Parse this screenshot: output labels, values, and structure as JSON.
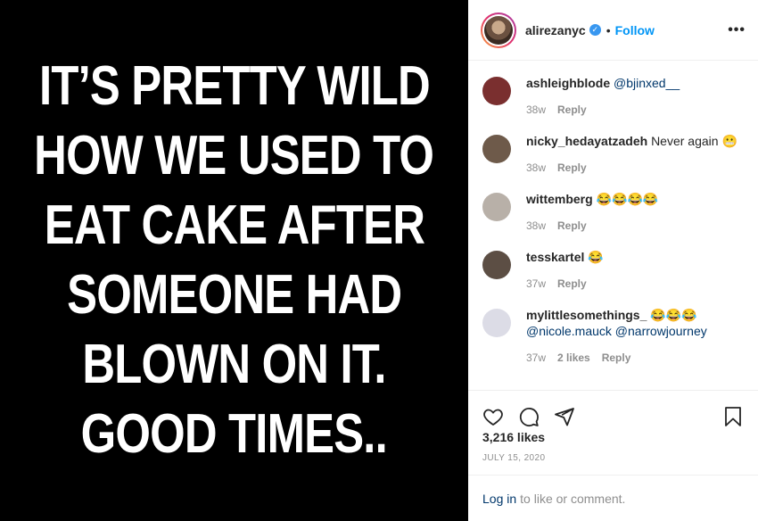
{
  "meme": {
    "lines": [
      "IT’S PRETTY WILD",
      "HOW WE USED TO",
      "EAT CAKE AFTER",
      "SOMEONE HAD",
      "BLOWN ON IT.",
      "GOOD TIMES.."
    ]
  },
  "header": {
    "username": "alirezanyc",
    "verified_mark": "✓",
    "separator": "•",
    "follow_label": "Follow",
    "more_label": "•••"
  },
  "comments": [
    {
      "user": "ashleighblode",
      "text": "",
      "mention": "@bjinxed__",
      "time": "38w",
      "likes": "",
      "reply": "Reply",
      "avatar_color": "#7a2f2f"
    },
    {
      "user": "nicky_hedayatzadeh",
      "text": "Never again 😬",
      "mention": "",
      "time": "38w",
      "likes": "",
      "reply": "Reply",
      "avatar_color": "#6e5a4a"
    },
    {
      "user": "wittemberg",
      "text": "😂😂😂😂",
      "mention": "",
      "time": "38w",
      "likes": "",
      "reply": "Reply",
      "avatar_color": "#b8b0a8"
    },
    {
      "user": "tesskartel",
      "text": "😂",
      "mention": "",
      "time": "37w",
      "likes": "",
      "reply": "Reply",
      "avatar_color": "#5c4e44"
    },
    {
      "user": "mylittlesomethings_",
      "text": "😂😂😂",
      "mention": "@nicole.mauck @narrowjourney",
      "time": "37w",
      "likes": "2 likes",
      "reply": "Reply",
      "avatar_color": "#dcdce6"
    }
  ],
  "footer": {
    "likes": "3,216 likes",
    "date": "July 15, 2020",
    "login_link": "Log in",
    "login_rest": "to like or comment."
  },
  "icons": [
    "heart-icon",
    "comment-icon",
    "share-icon",
    "bookmark-icon"
  ]
}
